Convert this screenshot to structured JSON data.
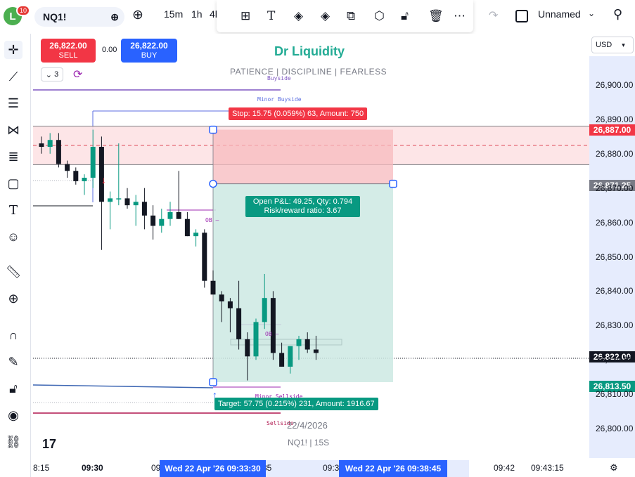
{
  "header": {
    "avatar_letter": "L",
    "notification_count": "10",
    "symbol": "NQ1!",
    "intervals": [
      "15m",
      "1h",
      "4h"
    ],
    "layout_name": "Unnamed"
  },
  "trading": {
    "sell_price": "26,822.00",
    "sell_label": "SELL",
    "spread": "0.00",
    "buy_price": "26,822.00",
    "buy_label": "BUY"
  },
  "indicators": {
    "count": "3"
  },
  "watermark": {
    "brand": "Dr Liquidity",
    "tagline": "PATIENCE  |  DISCIPLINE  |  FEARLESS",
    "date": "22/4/2026",
    "symbol_interval": "NQ1! | 15S"
  },
  "currency": "USD",
  "annotations": {
    "buyside": "Buyside",
    "minor_buyside": "Minor Buyside",
    "ob_upper": "OB –",
    "ob_lower": "OB –",
    "minor_sellside": "Minor Sellside",
    "sellside": "Sellside"
  },
  "position": {
    "stop_label": "Stop: 15.75 (0.059%) 63, Amount: 750",
    "pnl_line1": "Open P&L: 49.25, Qty: 0.794",
    "pnl_line2": "Risk/reward ratio: 3.67",
    "target_label": "Target: 57.75 (0.215%) 231, Amount: 1916.67"
  },
  "price_axis": {
    "ticks": [
      "26,900.00",
      "26,890.00",
      "26,880.00",
      "26,870.00",
      "26,860.00",
      "26,850.00",
      "26,840.00",
      "26,830.00",
      "26,820.00",
      "26,810.00",
      "26,800.00"
    ],
    "tag_stop": "26,887.00",
    "tag_entry": "26,871.25",
    "tag_last": "26,822.00",
    "tag_target": "26,813.50"
  },
  "time_axis": {
    "ticks": [
      "8:15",
      "09:30",
      "09",
      "35",
      "09:3",
      "09:42",
      "09:43:15"
    ],
    "cursor_start": "Wed 22 Apr '26   09:33:30",
    "cursor_end": "Wed 22 Apr '26   09:38:45"
  },
  "colors": {
    "up": "#089981",
    "down": "#131722",
    "stop_zone": "#f7c5c8",
    "target_zone": "#cde9e3",
    "accent": "#2962ff"
  },
  "chart_data": {
    "type": "candlestick",
    "x": [
      "09:29:30",
      "09:29:45",
      "09:30:00",
      "09:30:15",
      "09:30:30",
      "09:30:45",
      "09:31:00",
      "09:31:15",
      "09:31:30",
      "09:31:45",
      "09:32:00",
      "09:32:15",
      "09:32:30",
      "09:32:45",
      "09:33:00",
      "09:33:15",
      "09:33:30",
      "09:33:45",
      "09:34:00",
      "09:34:15",
      "09:34:30",
      "09:34:45",
      "09:35:00",
      "09:35:15",
      "09:35:30",
      "09:35:45",
      "09:36:00",
      "09:36:15",
      "09:36:30",
      "09:36:45",
      "09:37:00",
      "09:37:15",
      "09:37:30",
      "09:37:45",
      "09:38:00",
      "09:38:15",
      "09:38:30",
      "09:38:45"
    ],
    "ohlc": [
      [
        26883,
        26885,
        26880,
        26882
      ],
      [
        26882,
        26886,
        26880,
        26884
      ],
      [
        26884,
        26886,
        26876,
        26877
      ],
      [
        26877,
        26878,
        26873,
        26875
      ],
      [
        26875,
        26876,
        26871,
        26872
      ],
      [
        26872,
        26874,
        26868,
        26873
      ],
      [
        26873,
        26887,
        26870,
        26882
      ],
      [
        26882,
        26885,
        26852,
        26866
      ],
      [
        26866,
        26869,
        26858,
        26867
      ],
      [
        26867,
        26883,
        26865,
        26867
      ],
      [
        26867,
        26870,
        26864,
        26865
      ],
      [
        26865,
        26868,
        26859,
        26866
      ],
      [
        26866,
        26870,
        26858,
        26862
      ],
      [
        26862,
        26865,
        26855,
        26859
      ],
      [
        26859,
        26864,
        26857,
        26861
      ],
      [
        26861,
        26866,
        26859,
        26863
      ],
      [
        26863,
        26875,
        26861,
        26861
      ],
      [
        26861,
        26863,
        26856,
        26856
      ],
      [
        26856,
        26858,
        26853,
        26857
      ],
      [
        26857,
        26858,
        26841,
        26843
      ],
      [
        26843,
        26846,
        26840,
        26839
      ],
      [
        26839,
        26840,
        26831,
        26837
      ],
      [
        26837,
        26838,
        26828,
        26835
      ],
      [
        26835,
        26843,
        26823,
        26826
      ],
      [
        26826,
        26828,
        26814,
        26821
      ],
      [
        26821,
        26832,
        26820,
        26831
      ],
      [
        26831,
        26845,
        26829,
        26838
      ],
      [
        26838,
        26840,
        26820,
        26822
      ],
      [
        26822,
        26825,
        26818,
        26818
      ],
      [
        26818,
        26823,
        26816,
        26824
      ],
      [
        26824,
        26827,
        26820,
        26826
      ],
      [
        26826,
        26828,
        26822,
        26823
      ],
      [
        26823,
        26827,
        26820,
        26822
      ]
    ],
    "ylim": [
      26797,
      26913
    ],
    "levels": {
      "stop": 26887.0,
      "entry": 26871.25,
      "last": 26822.0,
      "target": 26813.5
    }
  }
}
